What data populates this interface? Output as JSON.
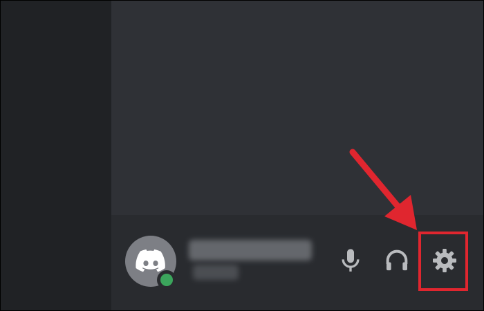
{
  "user_panel": {
    "username": "username",
    "tag": "#0000",
    "status": "online"
  },
  "controls": [
    {
      "name": "microphone",
      "icon": "microphone-icon"
    },
    {
      "name": "headphones",
      "icon": "headphones-icon"
    },
    {
      "name": "user-settings",
      "icon": "gear-icon"
    }
  ],
  "annotation": {
    "arrow_color": "#e0262f",
    "highlight_color": "#e0262f",
    "target": "user-settings"
  },
  "colors": {
    "server_rail": "#202225",
    "channel_pane": "#2f3136",
    "user_panel": "#292b2f",
    "status_online": "#3ba55c",
    "icon": "#b9bbbe"
  }
}
